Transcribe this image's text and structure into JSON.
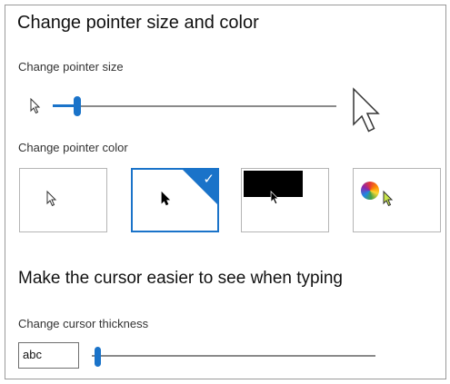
{
  "pointer_section": {
    "title": "Change pointer size and color",
    "size_label": "Change pointer size",
    "size_value": 0.08,
    "color_label": "Change pointer color",
    "color_options": [
      {
        "name": "white",
        "selected": false,
        "icon": "white-pointer-icon"
      },
      {
        "name": "black",
        "selected": true,
        "icon": "black-pointer-icon"
      },
      {
        "name": "inverted",
        "selected": false,
        "icon": "inverted-pointer-icon"
      },
      {
        "name": "custom",
        "selected": false,
        "icon": "color-wheel-pointer-icon"
      }
    ],
    "accent": "#1a73c9"
  },
  "cursor_section": {
    "title": "Make the cursor easier to see when typing",
    "thickness_label": "Change cursor thickness",
    "preview_text": "abc",
    "thickness_value": 0.0
  }
}
